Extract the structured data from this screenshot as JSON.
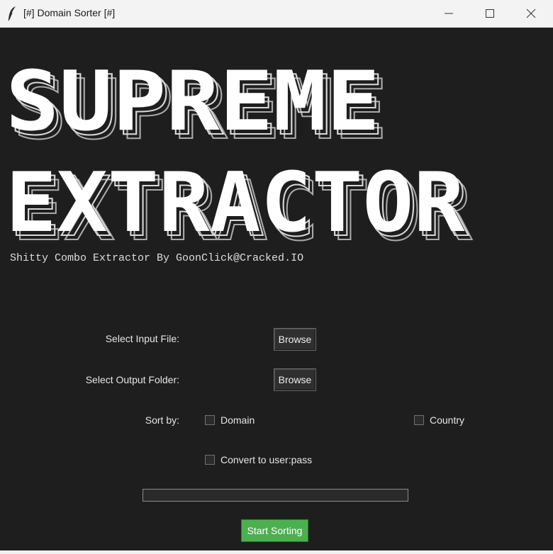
{
  "window": {
    "title": "[#] Domain Sorter [#]"
  },
  "banner": {
    "line1": "SUPREME",
    "line2": "EXTRACTOR",
    "subtitle": "Shitty Combo Extractor By GoonClick@Cracked.IO"
  },
  "form": {
    "input_file_label": "Select Input File:",
    "output_folder_label": "Select Output Folder:",
    "browse_label": "Browse",
    "sort_by_label": "Sort by:",
    "options": {
      "domain": {
        "label": "Domain",
        "checked": false
      },
      "country": {
        "label": "Country",
        "checked": false
      },
      "convert": {
        "label": "Convert to user:pass",
        "checked": false
      }
    }
  },
  "progress": {
    "value": 0
  },
  "actions": {
    "start_label": "Start Sorting"
  },
  "colors": {
    "background": "#1e1e1e",
    "start_button": "#4caf50",
    "text": "#e6e6e6"
  },
  "icons": {
    "app": "feather-icon",
    "minimize": "minimize-icon",
    "maximize": "maximize-icon",
    "close": "close-icon"
  }
}
